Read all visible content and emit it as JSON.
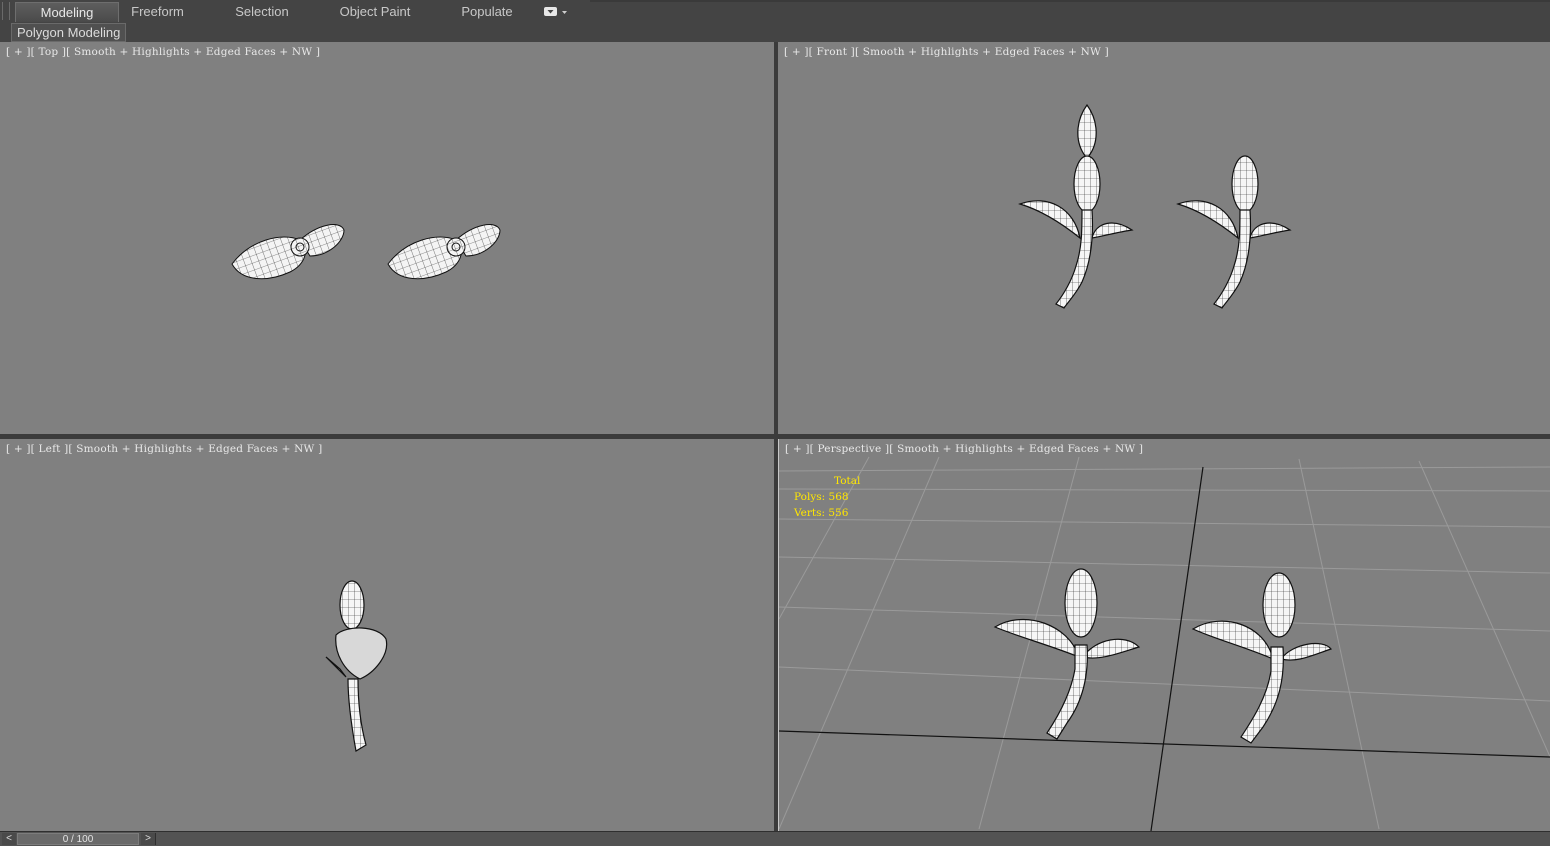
{
  "ribbon": {
    "tabs": [
      "Modeling",
      "Freeform",
      "Selection",
      "Object Paint",
      "Populate"
    ],
    "active_tab": "Modeling"
  },
  "panel": {
    "label": "Polygon Modeling"
  },
  "viewports": {
    "top": {
      "label": "[ + ][ Top ][ Smooth + Highlights + Edged Faces + NW ]"
    },
    "front": {
      "label": "[ + ][ Front ][ Smooth + Highlights + Edged Faces + NW ]"
    },
    "left": {
      "label": "[ + ][ Left ][ Smooth + Highlights + Edged Faces + NW ]"
    },
    "perspective": {
      "label": "[ + ][ Perspective ][ Smooth + Highlights + Edged Faces + NW ]"
    }
  },
  "stats": {
    "title": "Total",
    "polys_label": "Polys:",
    "polys_value": "568",
    "verts_label": "Verts:",
    "verts_value": "556"
  },
  "timeline": {
    "position": "0 / 100",
    "prev": "<",
    "next": ">"
  },
  "colors": {
    "viewport_bg": "#808080",
    "ui_bg": "#444444",
    "stats_text": "#ffe600",
    "mesh_fill": "#ffffff",
    "mesh_wire": "#000000"
  }
}
